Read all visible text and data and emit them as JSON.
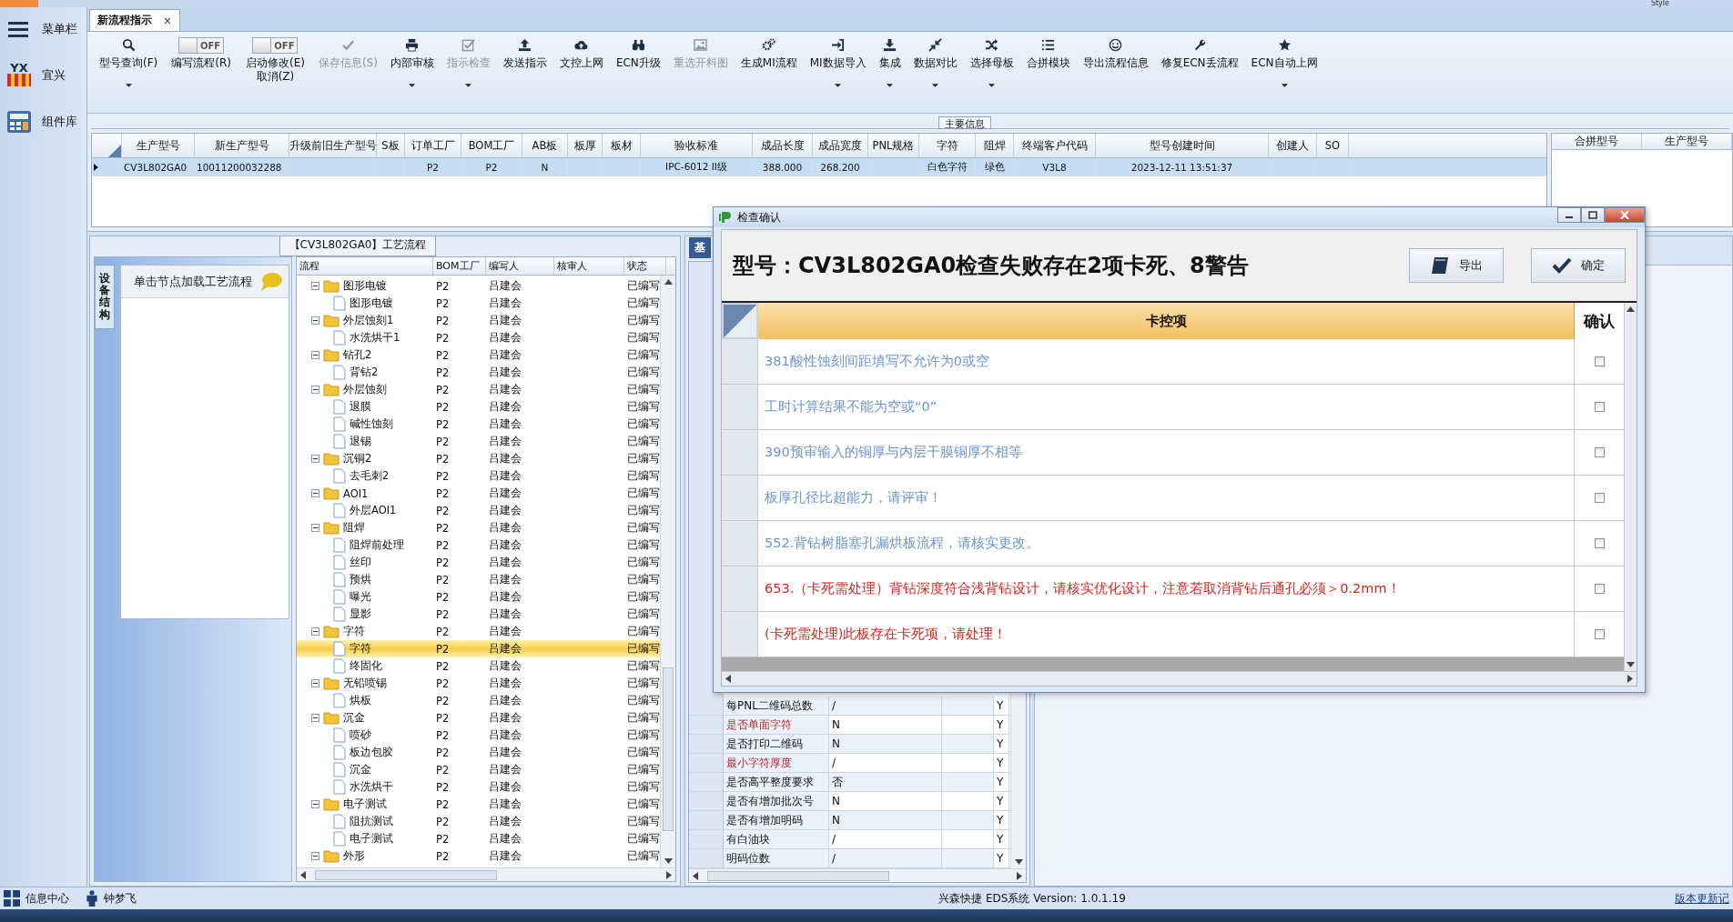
{
  "top_strip": {
    "style_menu": "Style"
  },
  "sidebar": {
    "items": [
      {
        "label": "菜单栏"
      },
      {
        "label": "宜兴",
        "logo_text": "YX"
      },
      {
        "label": "组件库"
      }
    ]
  },
  "tabs": [
    {
      "label": "新流程指示",
      "selected": true,
      "close_glyph": "×"
    }
  ],
  "toolbar": [
    {
      "kind": "button",
      "label": "型号查询(F)",
      "disabled": false,
      "dropdown": true
    },
    {
      "kind": "toggle",
      "label_lines": [
        "编写流程(R)"
      ],
      "on": false,
      "state_label": "OFF"
    },
    {
      "kind": "toggle",
      "label_lines": [
        "启动修改(E)",
        "取消(Z)"
      ],
      "on": false,
      "state_label": "OFF"
    },
    {
      "kind": "button",
      "label": "保存信息(S)",
      "disabled": true,
      "dropdown": false
    },
    {
      "kind": "button",
      "label": "内部审核",
      "disabled": false,
      "dropdown": true
    },
    {
      "kind": "button",
      "label": "指示检查",
      "disabled": true,
      "dropdown": true
    },
    {
      "kind": "button",
      "label": "发送指示",
      "disabled": false,
      "dropdown": false
    },
    {
      "kind": "button",
      "label": "文控上网",
      "disabled": false,
      "dropdown": false
    },
    {
      "kind": "button",
      "label": "ECN升级",
      "disabled": false,
      "dropdown": false
    },
    {
      "kind": "button",
      "label": "重选开料图",
      "disabled": true,
      "dropdown": false
    },
    {
      "kind": "button",
      "label": "生成MI流程",
      "disabled": false,
      "dropdown": false
    },
    {
      "kind": "button",
      "label": "MI数据导入",
      "disabled": false,
      "dropdown": true
    },
    {
      "kind": "button",
      "label": "集成",
      "disabled": false,
      "dropdown": true
    },
    {
      "kind": "button",
      "label": "数据对比",
      "disabled": false,
      "dropdown": true
    },
    {
      "kind": "button",
      "label": "选择母板",
      "disabled": false,
      "dropdown": true
    },
    {
      "kind": "button",
      "label": "合拼模块",
      "disabled": false,
      "dropdown": false
    },
    {
      "kind": "button",
      "label": "导出流程信息",
      "disabled": false,
      "dropdown": false
    },
    {
      "kind": "button",
      "label": "修复ECN丢流程",
      "disabled": false,
      "dropdown": false
    },
    {
      "kind": "button",
      "label": "ECN自动上网",
      "disabled": false,
      "dropdown": true
    }
  ],
  "main_info": {
    "legend": "主要信息",
    "table": {
      "columns": [
        "生产型号",
        "新生产型号",
        "升级前旧生产型号",
        "S板",
        "订单工厂",
        "BOM工厂",
        "AB板",
        "板厚",
        "板材",
        "验收标准",
        "成品长度",
        "成品宽度",
        "PNL规格",
        "字符",
        "阻焊",
        "终端客户代码",
        "型号创建时间",
        "创建人",
        "SO"
      ],
      "rows": [
        {
          "selected": true,
          "cells": [
            "CV3L802GA0",
            "10011200032288",
            "",
            "",
            "P2",
            "P2",
            "N",
            "",
            "",
            "IPC-6012 II级",
            "388.000",
            "268.200",
            "",
            "白色字符",
            "绿色",
            "V3L8",
            "2023-12-11 13:51:37",
            "",
            ""
          ]
        }
      ]
    },
    "merge_table": {
      "columns": [
        "合拼型号",
        "生产型号"
      ]
    }
  },
  "flow_panel": {
    "title": "【CV3L802GA0】工艺流程",
    "side_tab": "设备结构",
    "hint": "单击节点加载工艺流程",
    "columns": [
      "流程",
      "BOM工厂",
      "编写人",
      "核审人",
      "状态"
    ],
    "tree": [
      {
        "name": "图形电镀",
        "bom": "P2",
        "writer": "吕建会",
        "status": "已编写",
        "expanded": true,
        "selected": false,
        "children": [
          {
            "name": "图形电镀",
            "bom": "P2",
            "writer": "吕建会",
            "status": "已编写",
            "selected": false
          }
        ]
      },
      {
        "name": "外层蚀刻1",
        "bom": "P2",
        "writer": "吕建会",
        "status": "已编写",
        "expanded": true,
        "selected": false,
        "children": [
          {
            "name": "水洗烘干1",
            "bom": "P2",
            "writer": "吕建会",
            "status": "已编写",
            "selected": false
          }
        ]
      },
      {
        "name": "钻孔2",
        "bom": "P2",
        "writer": "吕建会",
        "status": "已编写",
        "expanded": true,
        "selected": false,
        "children": [
          {
            "name": "背钻2",
            "bom": "P2",
            "writer": "吕建会",
            "status": "已编写",
            "selected": false
          }
        ]
      },
      {
        "name": "外层蚀刻",
        "bom": "P2",
        "writer": "吕建会",
        "status": "已编写",
        "expanded": true,
        "selected": false,
        "children": [
          {
            "name": "退膜",
            "bom": "P2",
            "writer": "吕建会",
            "status": "已编写",
            "selected": false
          },
          {
            "name": "碱性蚀刻",
            "bom": "P2",
            "writer": "吕建会",
            "status": "已编写",
            "selected": false
          },
          {
            "name": "退锡",
            "bom": "P2",
            "writer": "吕建会",
            "status": "已编写",
            "selected": false
          }
        ]
      },
      {
        "name": "沉铜2",
        "bom": "P2",
        "writer": "吕建会",
        "status": "已编写",
        "expanded": true,
        "selected": false,
        "children": [
          {
            "name": "去毛刺2",
            "bom": "P2",
            "writer": "吕建会",
            "status": "已编写",
            "selected": false
          }
        ]
      },
      {
        "name": "AOI1",
        "bom": "P2",
        "writer": "吕建会",
        "status": "已编写",
        "expanded": true,
        "selected": false,
        "children": [
          {
            "name": "外层AOI1",
            "bom": "P2",
            "writer": "吕建会",
            "status": "已编写",
            "selected": false
          }
        ]
      },
      {
        "name": "阻焊",
        "bom": "P2",
        "writer": "吕建会",
        "status": "已编写",
        "expanded": true,
        "selected": false,
        "children": [
          {
            "name": "阻焊前处理",
            "bom": "P2",
            "writer": "吕建会",
            "status": "已编写",
            "selected": false
          },
          {
            "name": "丝印",
            "bom": "P2",
            "writer": "吕建会",
            "status": "已编写",
            "selected": false
          },
          {
            "name": "预烘",
            "bom": "P2",
            "writer": "吕建会",
            "status": "已编写",
            "selected": false
          },
          {
            "name": "曝光",
            "bom": "P2",
            "writer": "吕建会",
            "status": "已编写",
            "selected": false
          },
          {
            "name": "显影",
            "bom": "P2",
            "writer": "吕建会",
            "status": "已编写",
            "selected": false
          }
        ]
      },
      {
        "name": "字符",
        "bom": "P2",
        "writer": "吕建会",
        "status": "已编写",
        "expanded": true,
        "selected": false,
        "children": [
          {
            "name": "字符",
            "bom": "P2",
            "writer": "吕建会",
            "status": "已编写",
            "selected": true
          },
          {
            "name": "终固化",
            "bom": "P2",
            "writer": "吕建会",
            "status": "已编写",
            "selected": false
          }
        ]
      },
      {
        "name": "无铅喷锡",
        "bom": "P2",
        "writer": "吕建会",
        "status": "已编写",
        "expanded": true,
        "selected": false,
        "children": [
          {
            "name": "烘板",
            "bom": "P2",
            "writer": "吕建会",
            "status": "已编写",
            "selected": false
          }
        ]
      },
      {
        "name": "沉金",
        "bom": "P2",
        "writer": "吕建会",
        "status": "已编写",
        "expanded": true,
        "selected": false,
        "children": [
          {
            "name": "喷砂",
            "bom": "P2",
            "writer": "吕建会",
            "status": "已编写",
            "selected": false
          },
          {
            "name": "板边包胶",
            "bom": "P2",
            "writer": "吕建会",
            "status": "已编写",
            "selected": false
          },
          {
            "name": "沉金",
            "bom": "P2",
            "writer": "吕建会",
            "status": "已编写",
            "selected": false
          },
          {
            "name": "水洗烘干",
            "bom": "P2",
            "writer": "吕建会",
            "status": "已编写",
            "selected": false
          }
        ]
      },
      {
        "name": "电子测试",
        "bom": "P2",
        "writer": "吕建会",
        "status": "已编写",
        "expanded": true,
        "selected": false,
        "children": [
          {
            "name": "阻抗测试",
            "bom": "P2",
            "writer": "吕建会",
            "status": "已编写",
            "selected": false
          },
          {
            "name": "电子测试",
            "bom": "P2",
            "writer": "吕建会",
            "status": "已编写",
            "selected": false
          }
        ]
      },
      {
        "name": "外形",
        "bom": "P2",
        "writer": "吕建会",
        "status": "已编写",
        "expanded": true,
        "selected": false
      }
    ]
  },
  "params_panel": {
    "tab": "基",
    "rows": [
      {
        "name": "每PNL二维码总数",
        "value": "/",
        "flag": "Y",
        "highlight": false
      },
      {
        "name": "是否单面字符",
        "value": "N",
        "flag": "Y",
        "highlight": true
      },
      {
        "name": "是否打印二维码",
        "value": "N",
        "flag": "Y",
        "highlight": false
      },
      {
        "name": "最小字符厚度",
        "value": "/",
        "flag": "Y",
        "highlight": true
      },
      {
        "name": "是否高平整度要求",
        "value": "否",
        "flag": "Y",
        "highlight": false
      },
      {
        "name": "是否有增加批次号",
        "value": "N",
        "flag": "Y",
        "highlight": false
      },
      {
        "name": "是否有增加明码",
        "value": "N",
        "flag": "Y",
        "highlight": false
      },
      {
        "name": "有白油块",
        "value": "/",
        "flag": "Y",
        "highlight": false
      },
      {
        "name": "明码位数",
        "value": "/",
        "flag": "Y",
        "highlight": false
      }
    ]
  },
  "dialog": {
    "title": "检查确认",
    "heading": "型号：CV3L802GA0检查失败存在2项卡死、8警告",
    "buttons": [
      "导出",
      "确定"
    ],
    "columns": [
      "卡控项",
      "确认"
    ],
    "rows": [
      {
        "kind": "warning",
        "text": "381酸性蚀刻间距填写不允许为0或空",
        "checked": false
      },
      {
        "kind": "warning",
        "text": "工时计算结果不能为空或“0”",
        "checked": false
      },
      {
        "kind": "warning",
        "text": "390预审输入的铜厚与内层干膜铜厚不相等",
        "checked": false
      },
      {
        "kind": "warning",
        "text": "板厚孔径比超能力，请评审！",
        "checked": false
      },
      {
        "kind": "warning",
        "text": "552.背钻树脂塞孔漏烘板流程，请核实更改。",
        "checked": false
      },
      {
        "kind": "fatal",
        "text": "653.（卡死需处理）背钻深度符合浅背钻设计，请核实优化设计，注意若取消背钻后通孔必须＞0.2mm！",
        "checked": false
      },
      {
        "kind": "fatal",
        "text": "(卡死需处理)此板存在卡死项，请处理！",
        "checked": false
      }
    ]
  },
  "status_bar": {
    "info_center": "信息中心",
    "user": "钟梦飞",
    "system": "兴森快捷 EDS系统 Version: 1.0.1.19",
    "update_link": "版本更新记"
  }
}
